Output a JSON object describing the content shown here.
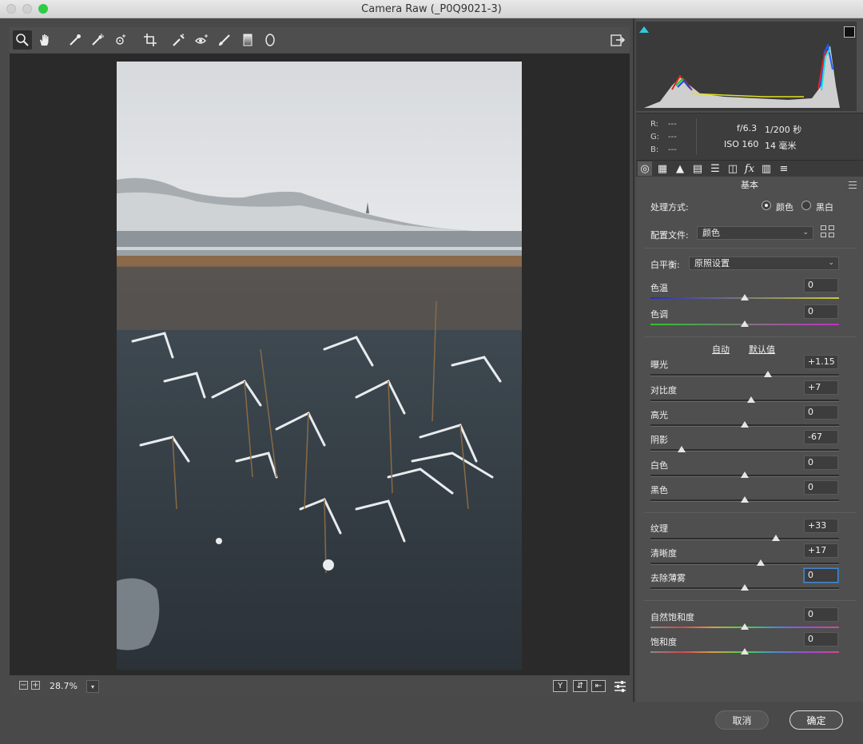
{
  "window": {
    "title": "Camera Raw (_P0Q9021-3)"
  },
  "toolbar": {
    "tools": [
      "zoom-icon",
      "hand-icon",
      "white-balance-icon",
      "color-sampler-icon",
      "targeted-adjustment-icon",
      "crop-icon",
      "spot-removal-icon",
      "red-eye-icon",
      "adjustment-brush-icon",
      "graduated-filter-icon",
      "radial-filter-icon"
    ],
    "export_icon": "open-preferences-icon"
  },
  "info": {
    "r_label": "R:",
    "r_value": "---",
    "g_label": "G:",
    "g_value": "---",
    "b_label": "B:",
    "b_value": "---",
    "aperture": "f/6.3",
    "shutter": "1/200 秒",
    "iso": "ISO 160",
    "focal": "14 毫米"
  },
  "panel": {
    "section_title": "基本",
    "treatment_label": "处理方式:",
    "treatment_color": "颜色",
    "treatment_bw": "黑白",
    "treatment_selected": "颜色",
    "profile_label": "配置文件:",
    "profile_value": "颜色",
    "wb_label": "白平衡:",
    "wb_value": "原照设置",
    "auto_label": "自动",
    "default_label": "默认值"
  },
  "sliders": [
    {
      "label": "色温",
      "value": "0",
      "level": 0.5
    },
    {
      "label": "色调",
      "value": "0",
      "level": 0.5
    },
    {
      "label": "曝光",
      "value": "+1.15",
      "level": 0.623
    },
    {
      "label": "对比度",
      "value": "+7",
      "level": 0.535
    },
    {
      "label": "高光",
      "value": "0",
      "level": 0.5
    },
    {
      "label": "阴影",
      "value": "-67",
      "level": 0.165
    },
    {
      "label": "白色",
      "value": "0",
      "level": 0.5
    },
    {
      "label": "黑色",
      "value": "0",
      "level": 0.5
    },
    {
      "label": "纹理",
      "value": "+33",
      "level": 0.665
    },
    {
      "label": "清晰度",
      "value": "+17",
      "level": 0.585
    },
    {
      "label": "去除薄雾",
      "value": "0",
      "level": 0.5
    },
    {
      "label": "自然饱和度",
      "value": "0",
      "level": 0.5
    },
    {
      "label": "饱和度",
      "value": "0",
      "level": 0.5
    }
  ],
  "status": {
    "zoom": "28.7%",
    "zoom_out": "−",
    "zoom_in": "+"
  },
  "footer": {
    "cancel": "取消",
    "ok": "确定"
  }
}
